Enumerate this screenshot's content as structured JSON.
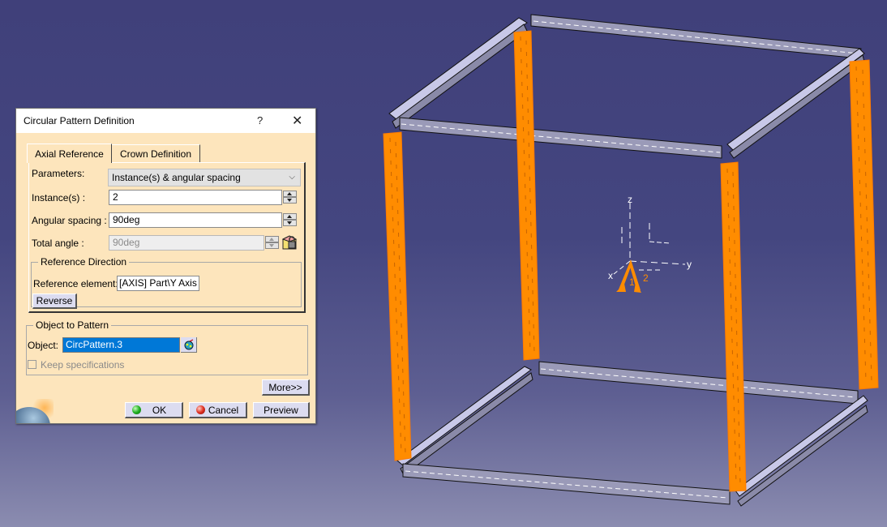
{
  "dialog": {
    "title": "Circular Pattern Definition",
    "help_label": "?",
    "close_label": "✕",
    "tabs": [
      {
        "label": "Axial Reference",
        "active": true
      },
      {
        "label": "Crown Definition",
        "active": false
      }
    ],
    "parameters": {
      "label": "Parameters:",
      "selected": "Instance(s) & angular spacing",
      "chevron": "⌵"
    },
    "instances": {
      "label": "Instance(s) :",
      "value": "2"
    },
    "angular_spacing": {
      "label": "Angular spacing :",
      "value": "90deg"
    },
    "total_angle": {
      "label": "Total angle :",
      "value": "90deg",
      "disabled": true
    },
    "reference_direction": {
      "legend": "Reference Direction",
      "element_label": "Reference element:",
      "element_value": "[AXIS] Part\\Y Axis",
      "reverse_label": "Reverse"
    },
    "object_to_pattern": {
      "legend": "Object to Pattern",
      "object_label": "Object:",
      "object_value": "CircPattern.3",
      "keep_specifications_label": "Keep specifications",
      "keep_specifications_checked": false
    },
    "more_label": "More>>",
    "ok_label": "OK",
    "cancel_label": "Cancel",
    "preview_label": "Preview"
  },
  "viewport": {
    "axis_labels": {
      "x": "x",
      "y": "y",
      "z": "z"
    },
    "instance_labels": [
      "1",
      "2"
    ],
    "colors": {
      "background_top": "#40407a",
      "background_bottom": "#8b8cb0",
      "highlight": "#ff8c00",
      "profile": "#9a9ab8",
      "profile_light": "#c8c8e8"
    }
  }
}
